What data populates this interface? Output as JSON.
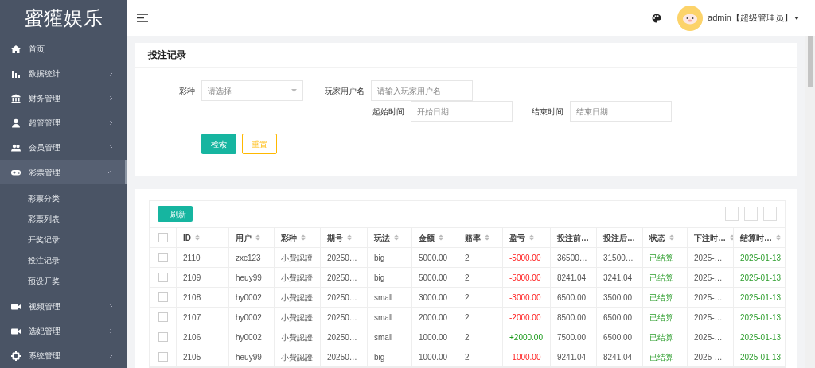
{
  "sidebar": {
    "logo": "蜜獾娱乐",
    "items": [
      {
        "label": "首页",
        "selected": false
      },
      {
        "label": "数据统计",
        "expanded": false,
        "selected": false
      },
      {
        "label": "财务管理",
        "expanded": false,
        "selected": false
      },
      {
        "label": "超管管理",
        "expanded": false,
        "selected": false
      },
      {
        "label": "会员管理",
        "expanded": false,
        "selected": false
      },
      {
        "label": "彩票管理",
        "expanded": true,
        "selected": true,
        "children": [
          {
            "label": "彩票分类"
          },
          {
            "label": "彩票列表"
          },
          {
            "label": "开奖记录"
          },
          {
            "label": "投注记录"
          },
          {
            "label": "预设开奖"
          }
        ]
      },
      {
        "label": "视频管理",
        "expanded": false,
        "selected": false
      },
      {
        "label": "选妃管理",
        "expanded": false,
        "selected": false
      },
      {
        "label": "系统管理",
        "expanded": false,
        "selected": false
      }
    ]
  },
  "header": {
    "user": "admin【超级管理员】"
  },
  "search_panel": {
    "title": "投注记录",
    "fields": [
      {
        "label": "彩种",
        "kind": "select",
        "placeholder": "请选择"
      },
      {
        "label": "玩家用户名",
        "kind": "input",
        "placeholder": "请输入玩家用户名"
      },
      {
        "label": "起始时间",
        "kind": "input",
        "placeholder": "开始日期"
      },
      {
        "label": "结束时间",
        "kind": "input",
        "placeholder": "结束日期"
      }
    ],
    "buttons": [
      {
        "label": "检索",
        "kind": "primary"
      },
      {
        "label": "重置",
        "kind": "outline"
      }
    ]
  },
  "table": {
    "refresh_button": "刷新",
    "select_all_checked": false,
    "columns": [
      {
        "label": "ID",
        "sortable": true
      },
      {
        "label": "用户",
        "sortable": true
      },
      {
        "label": "彩种",
        "sortable": true
      },
      {
        "label": "期号",
        "sortable": true
      },
      {
        "label": "玩法",
        "sortable": true
      },
      {
        "label": "金额",
        "sortable": true
      },
      {
        "label": "赔率",
        "sortable": true
      },
      {
        "label": "盈亏",
        "sortable": true
      },
      {
        "label": "投注前…",
        "sortable": false
      },
      {
        "label": "投注后…",
        "sortable": false
      },
      {
        "label": "状态",
        "sortable": true
      },
      {
        "label": "下注时…",
        "sortable": true
      },
      {
        "label": "结算时…",
        "sortable": true
      }
    ],
    "rows": [
      {
        "checked": false,
        "kind": "loss",
        "cells": [
          "2110",
          "zxc123",
          "小費認證",
          "20250…",
          "big",
          "5000.00",
          "2",
          "-5000.00",
          "36500…",
          "31500…",
          "已结算",
          "2025-…",
          "2025-01-13"
        ]
      },
      {
        "checked": false,
        "kind": "loss",
        "cells": [
          "2109",
          "heuy99",
          "小費認證",
          "20250…",
          "big",
          "5000.00",
          "2",
          "-5000.00",
          "8241.04",
          "3241.04",
          "已结算",
          "2025-…",
          "2025-01-13"
        ]
      },
      {
        "checked": false,
        "kind": "loss",
        "cells": [
          "2108",
          "hy0002",
          "小費認證",
          "20250…",
          "small",
          "3000.00",
          "2",
          "-3000.00",
          "6500.00",
          "3500.00",
          "已结算",
          "2025-…",
          "2025-01-13"
        ]
      },
      {
        "checked": false,
        "kind": "loss",
        "cells": [
          "2107",
          "hy0002",
          "小費認證",
          "20250…",
          "small",
          "2000.00",
          "2",
          "-2000.00",
          "8500.00",
          "6500.00",
          "已结算",
          "2025-…",
          "2025-01-13"
        ]
      },
      {
        "checked": false,
        "kind": "win",
        "cells": [
          "2106",
          "hy0002",
          "小費認證",
          "20250…",
          "small",
          "1000.00",
          "2",
          "+2000.00",
          "7500.00",
          "6500.00",
          "已结算",
          "2025-…",
          "2025-01-13"
        ]
      },
      {
        "checked": false,
        "kind": "loss",
        "cells": [
          "2105",
          "heuy99",
          "小費認證",
          "20250…",
          "big",
          "1000.00",
          "2",
          "-1000.00",
          "9241.04",
          "8241.04",
          "已结算",
          "2025-…",
          "2025-01-13"
        ]
      }
    ]
  }
}
